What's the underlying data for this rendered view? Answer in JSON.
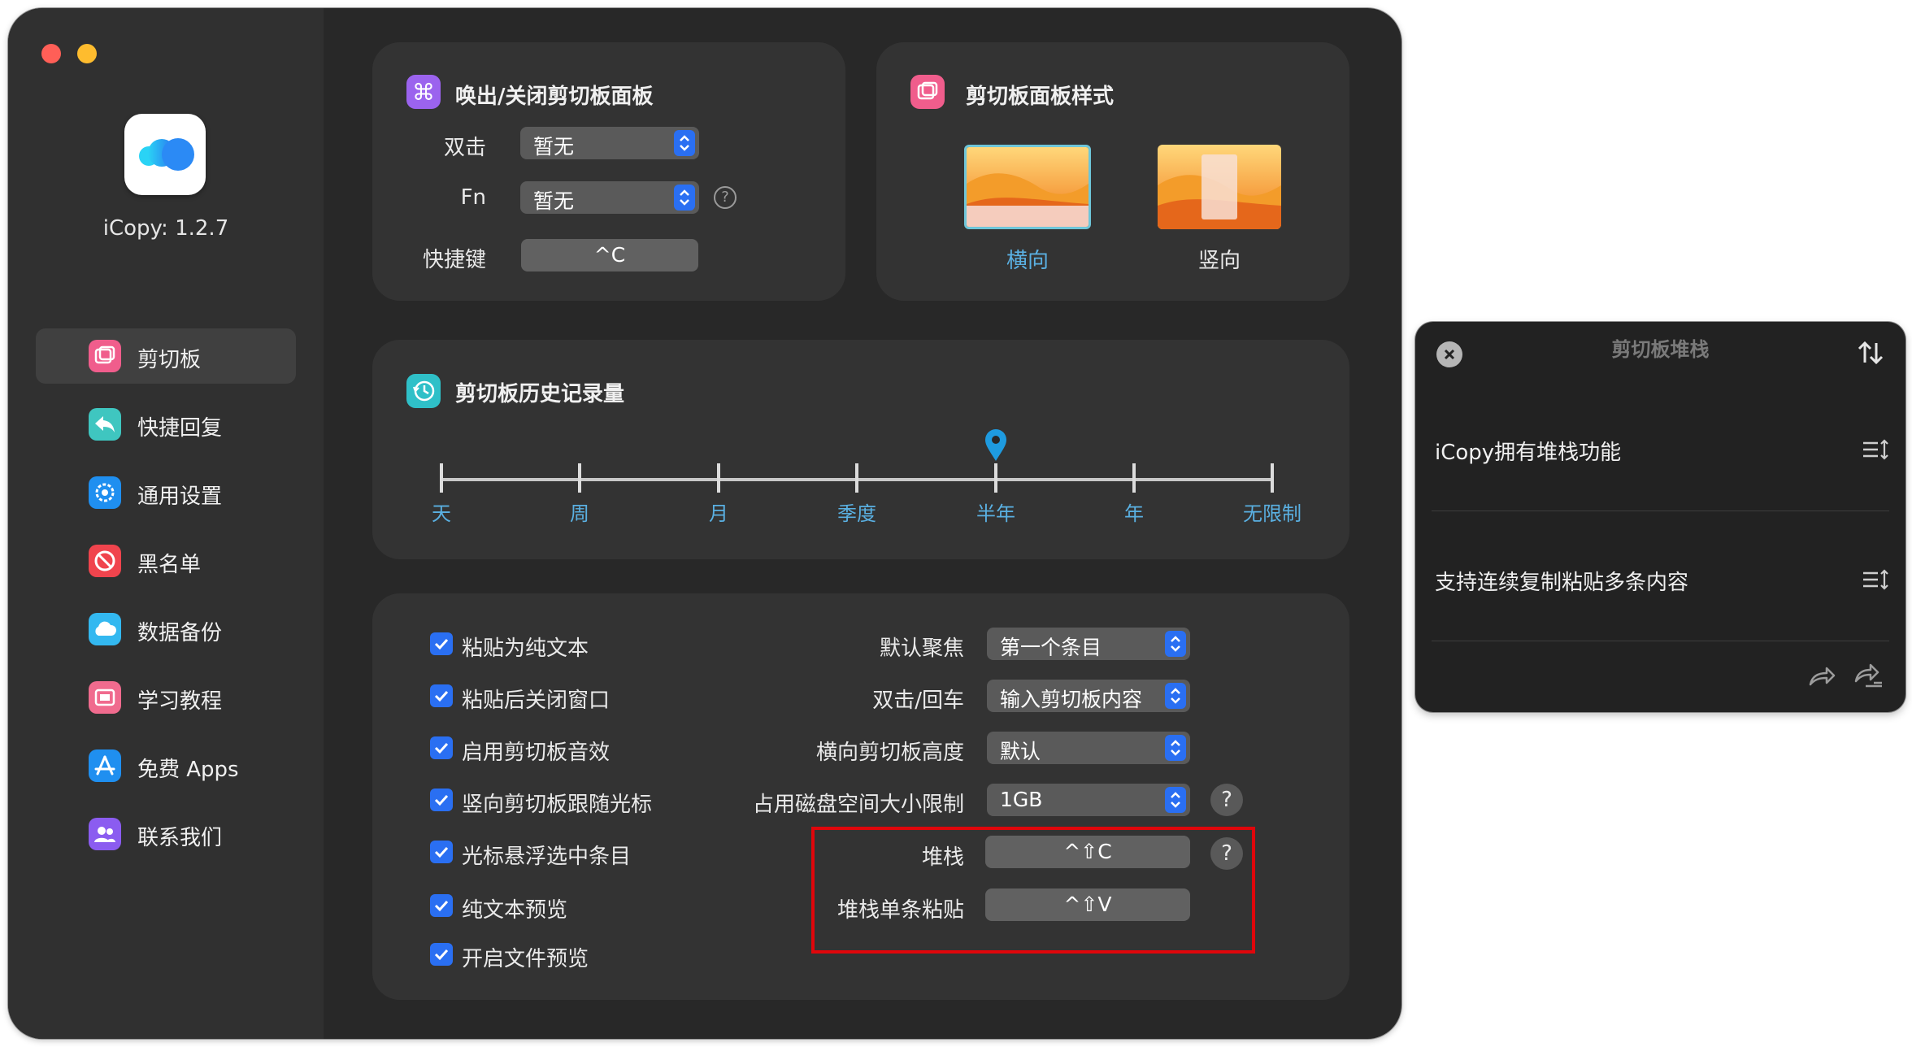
{
  "app": {
    "version_label": "iCopy: 1.2.7"
  },
  "sidebar": {
    "items": [
      {
        "label": "剪切板",
        "icon": "clipboard-icon",
        "color": "#f05d8c",
        "active": true
      },
      {
        "label": "快捷回复",
        "icon": "quick-reply-icon",
        "color": "#3fc6c0",
        "active": false
      },
      {
        "label": "通用设置",
        "icon": "gear-icon",
        "color": "#1f8ff0",
        "active": false
      },
      {
        "label": "黑名单",
        "icon": "block-icon",
        "color": "#f0444d",
        "active": false
      },
      {
        "label": "数据备份",
        "icon": "cloud-icon",
        "color": "#33b8f0",
        "active": false
      },
      {
        "label": "学习教程",
        "icon": "tutorial-icon",
        "color": "#f06b8e",
        "active": false
      },
      {
        "label": "免费 Apps",
        "icon": "app-store-icon",
        "color": "#1f8ff0",
        "active": false
      },
      {
        "label": "联系我们",
        "icon": "contact-icon",
        "color": "#8b5cf0",
        "active": false
      }
    ]
  },
  "toggle_card": {
    "title": "唤出/关闭剪切板面板",
    "double_click_label": "双击",
    "double_click_value": "暂无",
    "fn_label": "Fn",
    "fn_value": "暂无",
    "hotkey_label": "快捷键",
    "hotkey_value": "^C"
  },
  "style_card": {
    "title": "剪切板面板样式",
    "options": [
      {
        "label": "横向",
        "selected": true
      },
      {
        "label": "竖向",
        "selected": false
      }
    ]
  },
  "history_card": {
    "title": "剪切板历史记录量",
    "ticks": [
      "天",
      "周",
      "月",
      "季度",
      "半年",
      "年",
      "无限制"
    ],
    "selected": "半年"
  },
  "options_card": {
    "checkboxes": [
      {
        "label": "粘贴为纯文本",
        "checked": true
      },
      {
        "label": "粘贴后关闭窗口",
        "checked": true
      },
      {
        "label": "启用剪切板音效",
        "checked": true
      },
      {
        "label": "竖向剪切板跟随光标",
        "checked": true
      },
      {
        "label": "光标悬浮选中条目",
        "checked": true
      },
      {
        "label": "纯文本预览",
        "checked": true
      },
      {
        "label": "开启文件预览",
        "checked": true
      }
    ],
    "default_focus_label": "默认聚焦",
    "default_focus_value": "第一个条目",
    "enter_label": "双击/回车",
    "enter_value": "输入剪切板内容",
    "height_label": "横向剪切板高度",
    "height_value": "默认",
    "disk_label": "占用磁盘空间大小限制",
    "disk_value": "1GB",
    "stack_label": "堆栈",
    "stack_value": "^⇧C",
    "stack_single_label": "堆栈单条粘贴",
    "stack_single_value": "^⇧V",
    "help_glyph": "?"
  },
  "stack_panel": {
    "title": "剪切板堆栈",
    "items": [
      "iCopy拥有堆栈功能",
      "支持连续复制粘贴多条内容"
    ]
  },
  "colors": {
    "accent_blue": "#2a6ff2",
    "tick_label": "#5ab0e2",
    "highlight_red": "#e0060b"
  }
}
